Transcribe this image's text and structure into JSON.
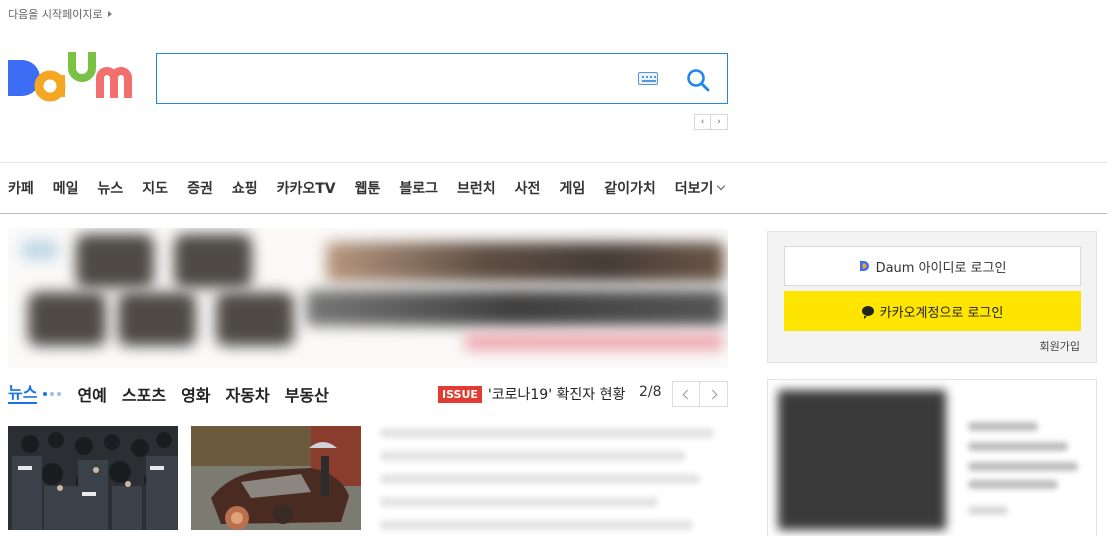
{
  "top": {
    "start_page_link": "다음을 시작페이지로"
  },
  "logo": {
    "alt": "Daum",
    "colors": [
      "#3d6df5",
      "#f5a623",
      "#7bc144",
      "#f26f6f",
      "#1da1f2"
    ]
  },
  "search": {
    "value": "",
    "placeholder": ""
  },
  "gnb": {
    "items": [
      "카페",
      "메일",
      "뉴스",
      "지도",
      "증권",
      "쇼핑",
      "카카오TV",
      "웹툰",
      "블로그",
      "브런치",
      "사전",
      "게임",
      "같이가치"
    ],
    "more_label": "더보기"
  },
  "news": {
    "tabs": [
      "뉴스",
      "연예",
      "스포츠",
      "영화",
      "자동차",
      "부동산"
    ],
    "issue_badge": "ISSUE",
    "issue_text": "'코로나19' 확진자 현황",
    "page_indicator": "2/8"
  },
  "login": {
    "daum_login_label": "Daum 아이디로 로그인",
    "kakao_login_label": "카카오계정으로 로그인",
    "signup_label": "회원가입"
  },
  "colors": {
    "accent": "#1a73e8",
    "kakao_yellow": "#fee500",
    "issue_red": "#e03c31",
    "search_border": "#1e88e5"
  }
}
